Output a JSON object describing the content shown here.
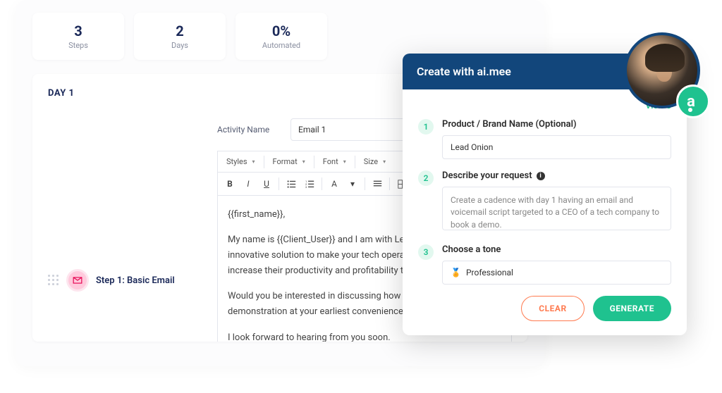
{
  "stats": [
    {
      "value": "3",
      "label": "Steps"
    },
    {
      "value": "2",
      "label": "Days"
    },
    {
      "value": "0%",
      "label": "Automated"
    }
  ],
  "day": {
    "title": "DAY 1"
  },
  "step": {
    "label": "Step 1: Basic Email"
  },
  "activity": {
    "label": "Activity Name",
    "value": "Email 1"
  },
  "toolbar": {
    "selects": {
      "styles": "Styles",
      "format": "Format",
      "font": "Font",
      "size": "Size"
    }
  },
  "email_body": {
    "greeting": "{{first_name}},",
    "p1": "My name is {{Client_User}} and I am with Lead Onion. We have an innovative solution to make your tech operations smoother and increase their productivity and profitability through our software.",
    "p2": "Would you be interested in discussing how Lead Onion can help? A demonstration at your earliest convenience.",
    "p3": "I look forward to hearing from you soon."
  },
  "ai": {
    "header": "Create with ai.mee",
    "view_link": "View S",
    "step1": {
      "label": "Product / Brand Name (Optional)",
      "value": "Lead Onion"
    },
    "step2": {
      "label": "Describe your request",
      "value": "Create a cadence with day 1 having an email and voicemail script targeted to a CEO of a tech company to book a demo."
    },
    "step3": {
      "label": "Choose a tone",
      "value": "Professional",
      "emoji": "🏅"
    },
    "clear": "CLEAR",
    "generate": "GENERATE"
  },
  "logo": {
    "letter": "a"
  }
}
